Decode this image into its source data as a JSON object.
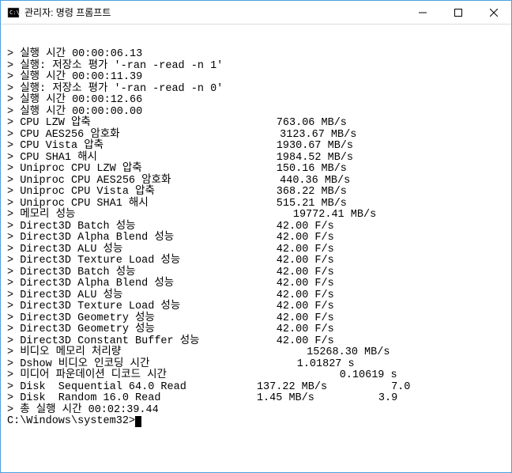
{
  "window": {
    "title": "관리자: 명령 프롬프트"
  },
  "lines": [
    "> 실행 시간 00:00:06.13",
    "> 실행: 저장소 평가 '-ran -read -n 1'",
    "> 실행 시간 00:00:11.39",
    "> 실행: 저장소 평가 '-ran -read -n 0'",
    "> 실행 시간 00:00:12.66",
    "> 실행 시간 00:00:00.00",
    "> CPU LZW 압축                             763.06 MB/s",
    "> CPU AES256 암호화                         3123.67 MB/s",
    "> CPU Vista 압축                           1930.67 MB/s",
    "> CPU SHA1 해시                            1984.52 MB/s",
    "> Uniproc CPU LZW 압축                     150.16 MB/s",
    "> Uniproc CPU AES256 암호화                 440.36 MB/s",
    "> Uniproc CPU Vista 압축                   368.22 MB/s",
    "> Uniproc CPU SHA1 해시                    515.21 MB/s",
    "> 메모리 성능                                  19772.41 MB/s",
    "> Direct3D Batch 성능                      42.00 F/s",
    "> Direct3D Alpha Blend 성능                42.00 F/s",
    "> Direct3D ALU 성능                        42.00 F/s",
    "> Direct3D Texture Load 성능               42.00 F/s",
    "> Direct3D Batch 성능                      42.00 F/s",
    "> Direct3D Alpha Blend 성능                42.00 F/s",
    "> Direct3D ALU 성능                        42.00 F/s",
    "> Direct3D Texture Load 성능               42.00 F/s",
    "> Direct3D Geometry 성능                   42.00 F/s",
    "> Direct3D Geometry 성능                   42.00 F/s",
    "> Direct3D Constant Buffer 성능            42.00 F/s",
    "> 비디오 메모리 처리량                             15268.30 MB/s",
    "> Dshow 비디오 인코딩 시간                       1.01827 s",
    "> 미디어 파운데이션 디코드 시간                           0.10619 s",
    "> Disk  Sequential 64.0 Read           137.22 MB/s          7.0",
    "> Disk  Random 16.0 Read               1.45 MB/s          3.9",
    "> 총 실행 시간 00:02:39.44",
    ""
  ],
  "prompt": "C:\\Windows\\system32>"
}
